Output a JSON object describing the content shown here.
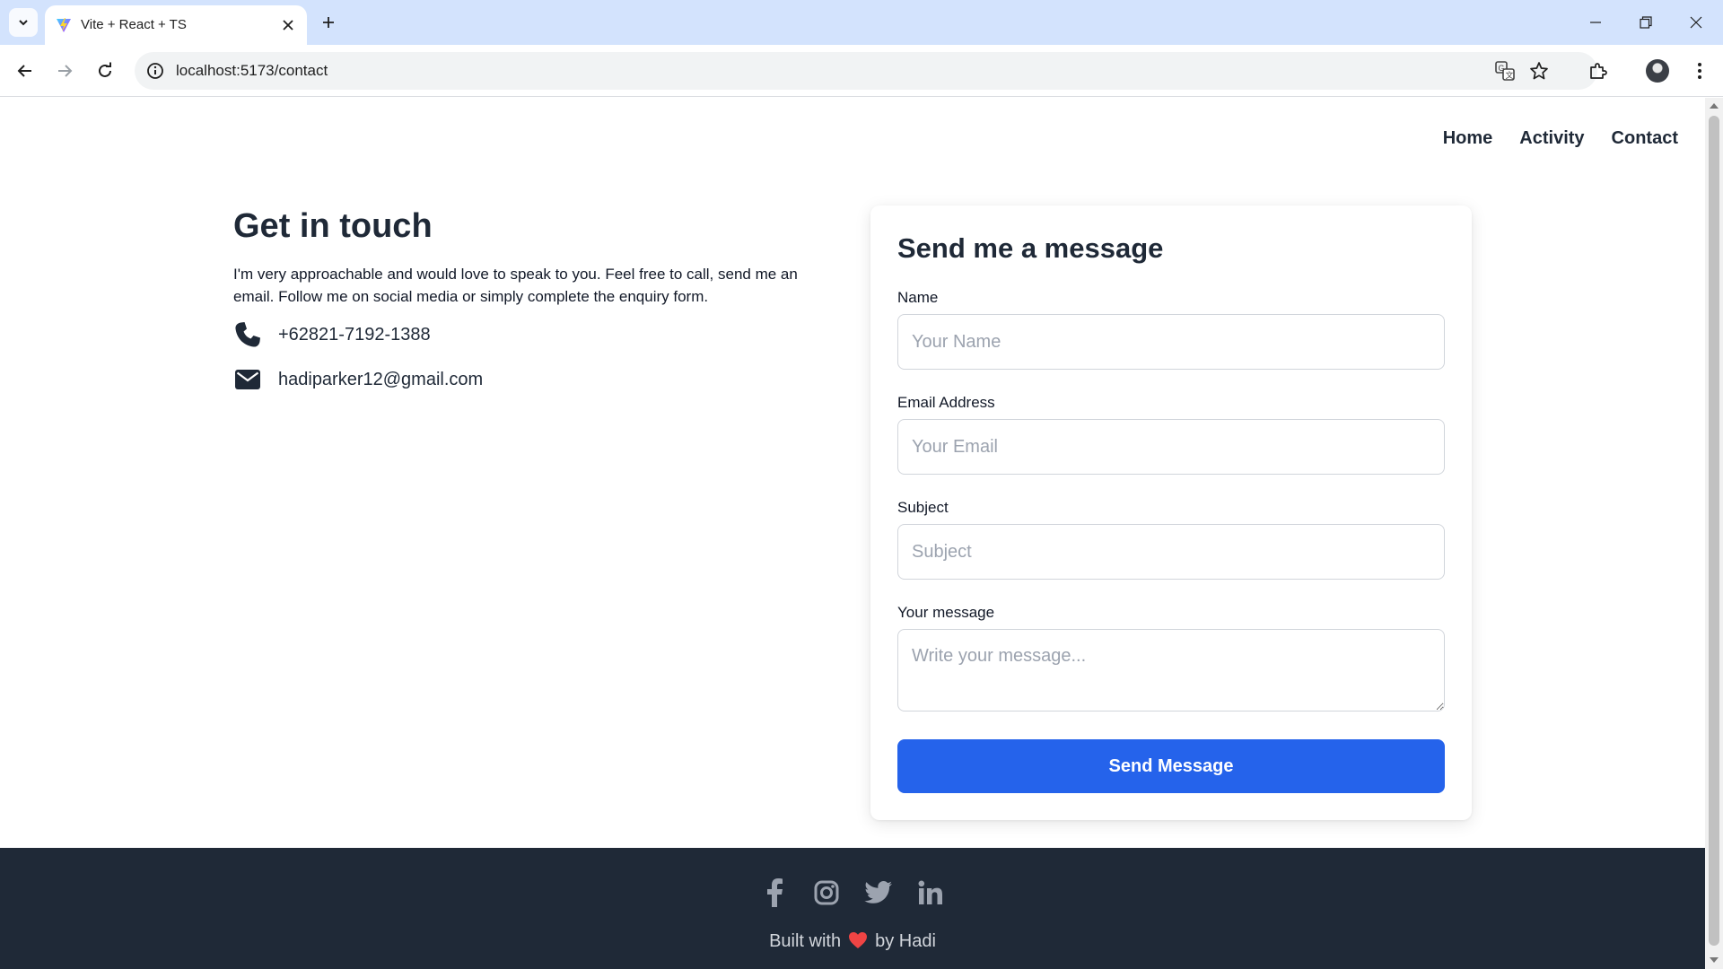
{
  "browser": {
    "tab_title": "Vite + React + TS",
    "url": "localhost:5173/contact"
  },
  "nav": {
    "home": "Home",
    "activity": "Activity",
    "contact": "Contact"
  },
  "contact_info": {
    "heading": "Get in touch",
    "intro": "I'm very approachable and would love to speak to you. Feel free to call, send me an email. Follow me on social media or simply complete the enquiry form.",
    "phone": "+62821-7192-1388",
    "email": "hadiparker12@gmail.com"
  },
  "form": {
    "title": "Send me a message",
    "name_label": "Name",
    "name_placeholder": "Your Name",
    "email_label": "Email Address",
    "email_placeholder": "Your Email",
    "subject_label": "Subject",
    "subject_placeholder": "Subject",
    "message_label": "Your message",
    "message_placeholder": "Write your message...",
    "submit_label": "Send Message"
  },
  "footer": {
    "built_prefix": "Built with",
    "built_suffix": "by Hadi",
    "social_icons": [
      "facebook-icon",
      "instagram-icon",
      "twitter-icon",
      "linkedin-icon"
    ]
  },
  "colors": {
    "primary_button": "#2563eb",
    "footer_bg": "#1f2937",
    "heart": "#ef4444"
  }
}
